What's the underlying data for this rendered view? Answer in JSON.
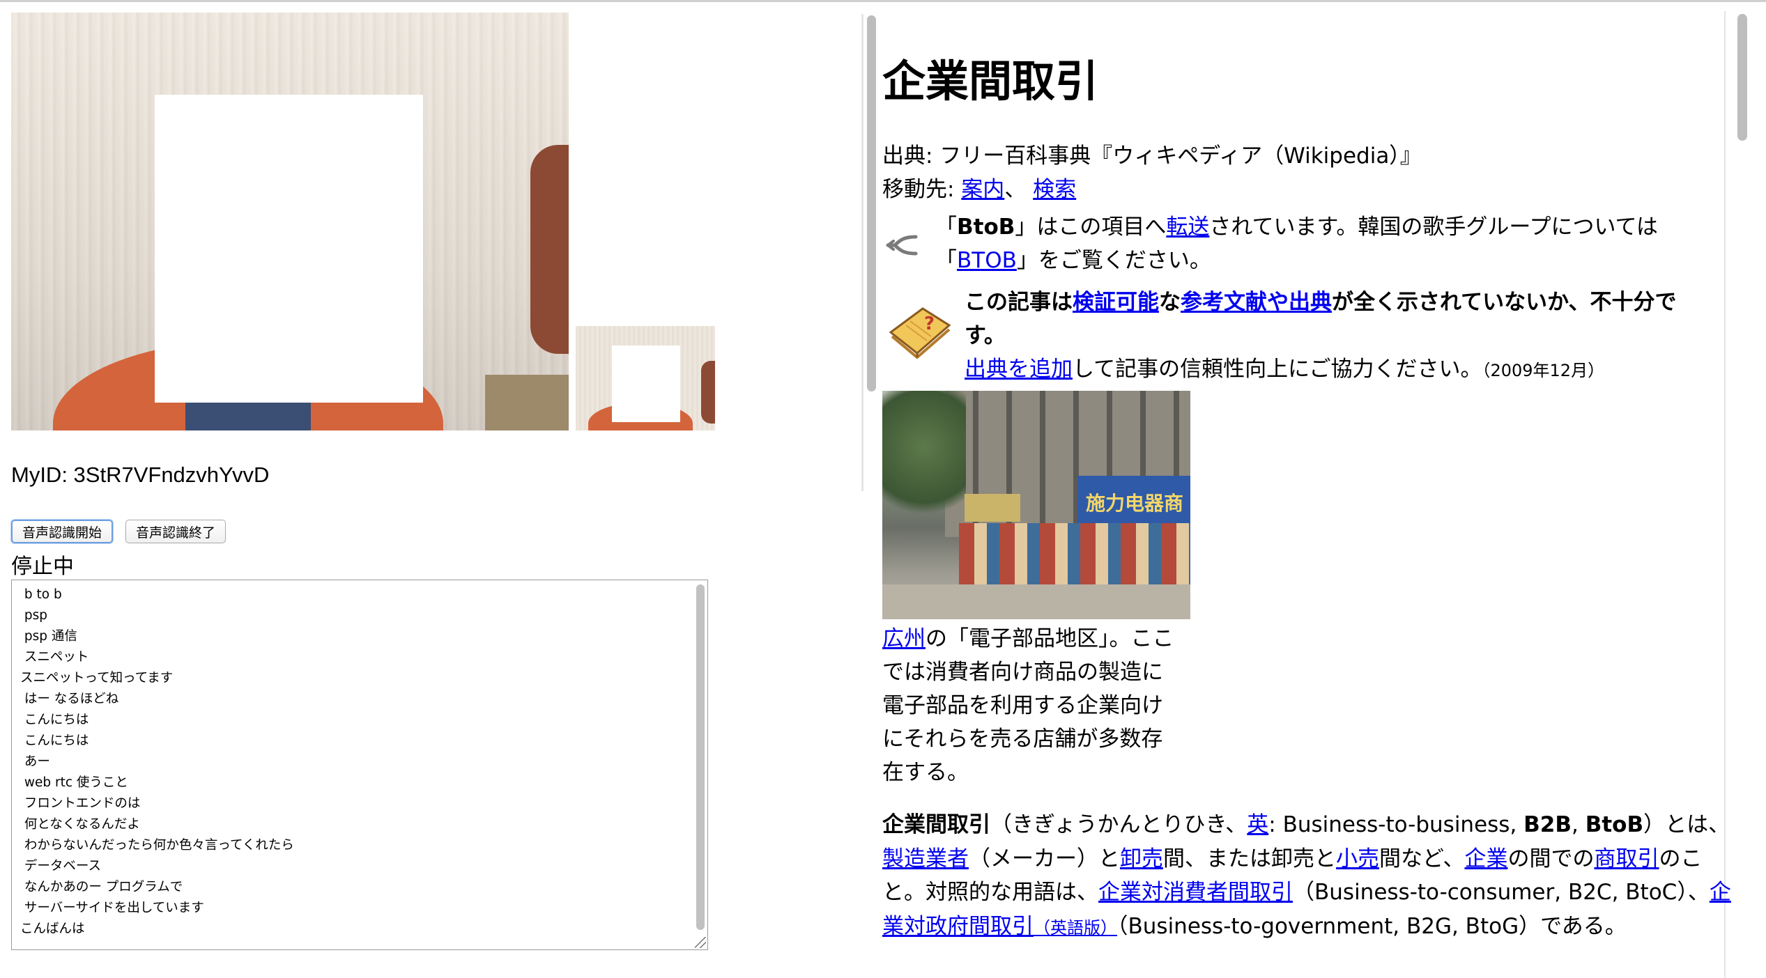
{
  "left": {
    "my_id": "MyID: 3StR7VFndzvhYvvD",
    "buttons": {
      "start": "音声認識開始",
      "stop": "音声認識終了"
    },
    "status": "停止中",
    "transcript": [
      " b to b",
      " psp",
      " psp 通信",
      " スニペット",
      "スニペットって知ってます",
      " はー なるほどね",
      " こんにちは",
      " こんにちは",
      " あー",
      " web rtc 使うこと",
      " フロントエンドのは",
      " 何となくなるんだよ",
      " わからないんだったら何か色々言ってくれたら",
      " データベース",
      " なんかあのー プログラムで",
      " サーバーサイドを出しています",
      "こんばんは"
    ]
  },
  "article": {
    "title": "企業間取引",
    "source": "出典: フリー百科事典『ウィキペディア（Wikipedia）』",
    "nav_prefix": "移動先: ",
    "nav_guide": "案内",
    "nav_sep": "、 ",
    "nav_search": "検索",
    "hatnote": {
      "l1_a": "「",
      "l1_bold": "BtoB",
      "l1_b": "」はこの項目へ",
      "l1_link": "転送",
      "l1_c": "されています。韓国の歌手グループについては",
      "l2_a": "「",
      "l2_link": "BTOB",
      "l2_b": "」をご覧ください。"
    },
    "ambox": {
      "l1_a": "この記事は",
      "l1_link1": "検証可能",
      "l1_b": "な",
      "l1_link2": "参考文献や出典",
      "l1_c": "が全く示されていないか、不十分で",
      "l2": "す。",
      "l3_link": "出典を追加",
      "l3_a": "して記事の信頼性向上にご協力ください。",
      "l3_date": "（2009年12月）"
    },
    "image_sign": "施力电器商",
    "caption": {
      "link": "広州",
      "text": "の「電子部品地区」。ここでは消費者向け商品の製造に電子部品を利用する企業向けにそれらを売る店舗が多数存在する。"
    },
    "intro": {
      "bold1": "企業間取引",
      "t1": "（きぎょうかんとりひき、",
      "link_en": "英",
      "t2": ": Business-to-business, ",
      "bold2": "B2B",
      "t3": ", ",
      "bold3": "BtoB",
      "t4": "）とは、",
      "link_mfr": "製造業者",
      "t5": "（メーカー）と",
      "link_wholesale": "卸売",
      "t6": "間、または卸売と",
      "link_retail": "小売",
      "t7": "間など、",
      "link_company": "企業",
      "t8": "の間での",
      "link_commerce": "商取引",
      "t9": "のこと。対照的な用語は、",
      "link_b2c": "企業対消費者間取引",
      "t10": "（Business-to-consumer, B2C, BtoC）、",
      "link_b2g": "企業対政府間取引",
      "link_en_ver": "（英語版）",
      "t11": "（Business-to-government, B2G, BtoG）である。"
    }
  }
}
